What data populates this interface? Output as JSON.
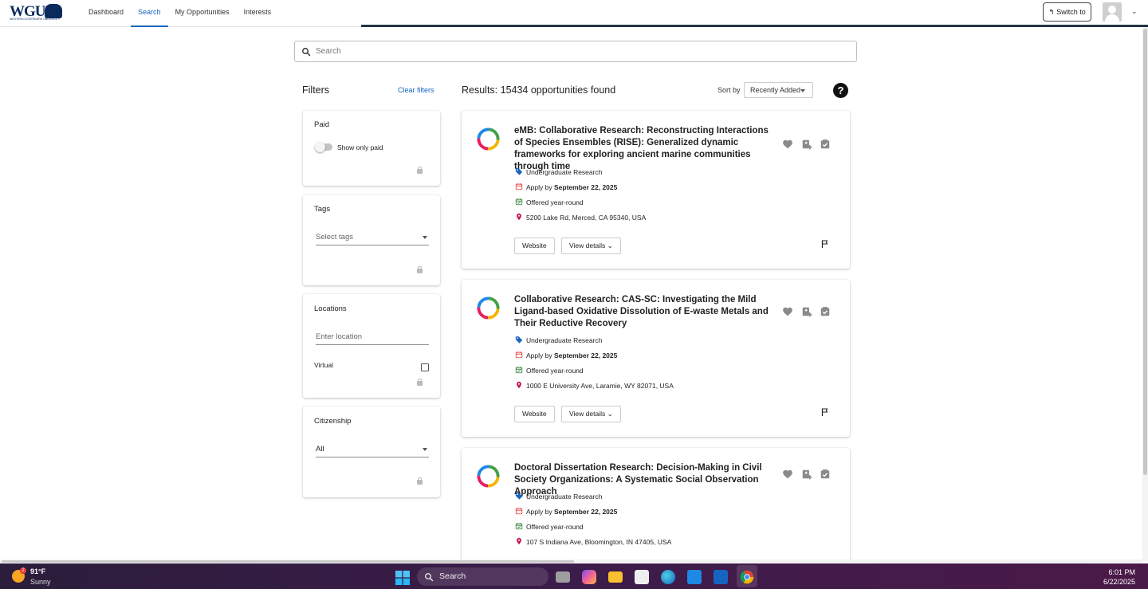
{
  "app": {
    "logo_text": "WGU",
    "logo_tagline": "WESTERN GOVERNORS UNIVERSITY"
  },
  "nav": {
    "items": [
      {
        "label": "Dashboard"
      },
      {
        "label": "Search"
      },
      {
        "label": "My Opportunities"
      },
      {
        "label": "Interests"
      }
    ],
    "active": "Search"
  },
  "header": {
    "switch_label": "↰ Switch to"
  },
  "search": {
    "placeholder": "Search"
  },
  "filters": {
    "title": "Filters",
    "clear_label": "Clear filters",
    "paid": {
      "label": "Paid",
      "toggle_label": "Show only paid",
      "checked": false
    },
    "tags": {
      "label": "Tags",
      "placeholder": "Select tags"
    },
    "locations": {
      "label": "Locations",
      "placeholder": "Enter location",
      "virtual_label": "Virtual",
      "virtual_checked": false
    },
    "citizenship": {
      "label": "Citizenship",
      "value": "All"
    }
  },
  "results": {
    "title": "Results: 15434 opportunities found",
    "sort_label": "Sort by",
    "sort_value": "Recently Added",
    "help_label": "?",
    "items": [
      {
        "title": "eMB: Collaborative Research: Reconstructing Interactions of Species Ensembles (RISE): Generalized dynamic frameworks for exploring ancient marine communities through time",
        "tag": "Undergraduate Research",
        "apply_prefix": "Apply by",
        "apply_date": "September 22, 2025",
        "offered": "Offered year-round",
        "location": "5200 Lake Rd, Merced, CA 95340, USA",
        "website_label": "Website",
        "details_label": "View details"
      },
      {
        "title": "Collaborative Research: CAS-SC: Investigating the Mild Ligand-based Oxidative Dissolution of E-waste Metals and Their Reductive Recovery",
        "tag": "Undergraduate Research",
        "apply_prefix": "Apply by",
        "apply_date": "September 22, 2025",
        "offered": "Offered year-round",
        "location": "1000 E University Ave, Laramie, WY 82071, USA",
        "website_label": "Website",
        "details_label": "View details"
      },
      {
        "title": "Doctoral Dissertation Research: Decision-Making in Civil Society Organizations: A Systematic Social Observation Approach",
        "tag": "Undergraduate Research",
        "apply_prefix": "Apply by",
        "apply_date": "September 22, 2025",
        "offered": "Offered year-round",
        "location": "107 S Indiana Ave, Bloomington, IN 47405, USA"
      }
    ]
  },
  "taskbar": {
    "weather_temp": "91°F",
    "weather_condition": "Sunny",
    "weather_badge": "2",
    "search_label": "Search",
    "time": "6:01 PM",
    "date": "6/22/2025"
  },
  "colors": {
    "accent": "#1565c0",
    "brand": "#0a2a5e",
    "progress": "#243447",
    "tag_icon": "#1565c0",
    "calendar_icon": "#e53935",
    "offered_icon": "#2e7d32",
    "location_icon": "#c2185b"
  }
}
